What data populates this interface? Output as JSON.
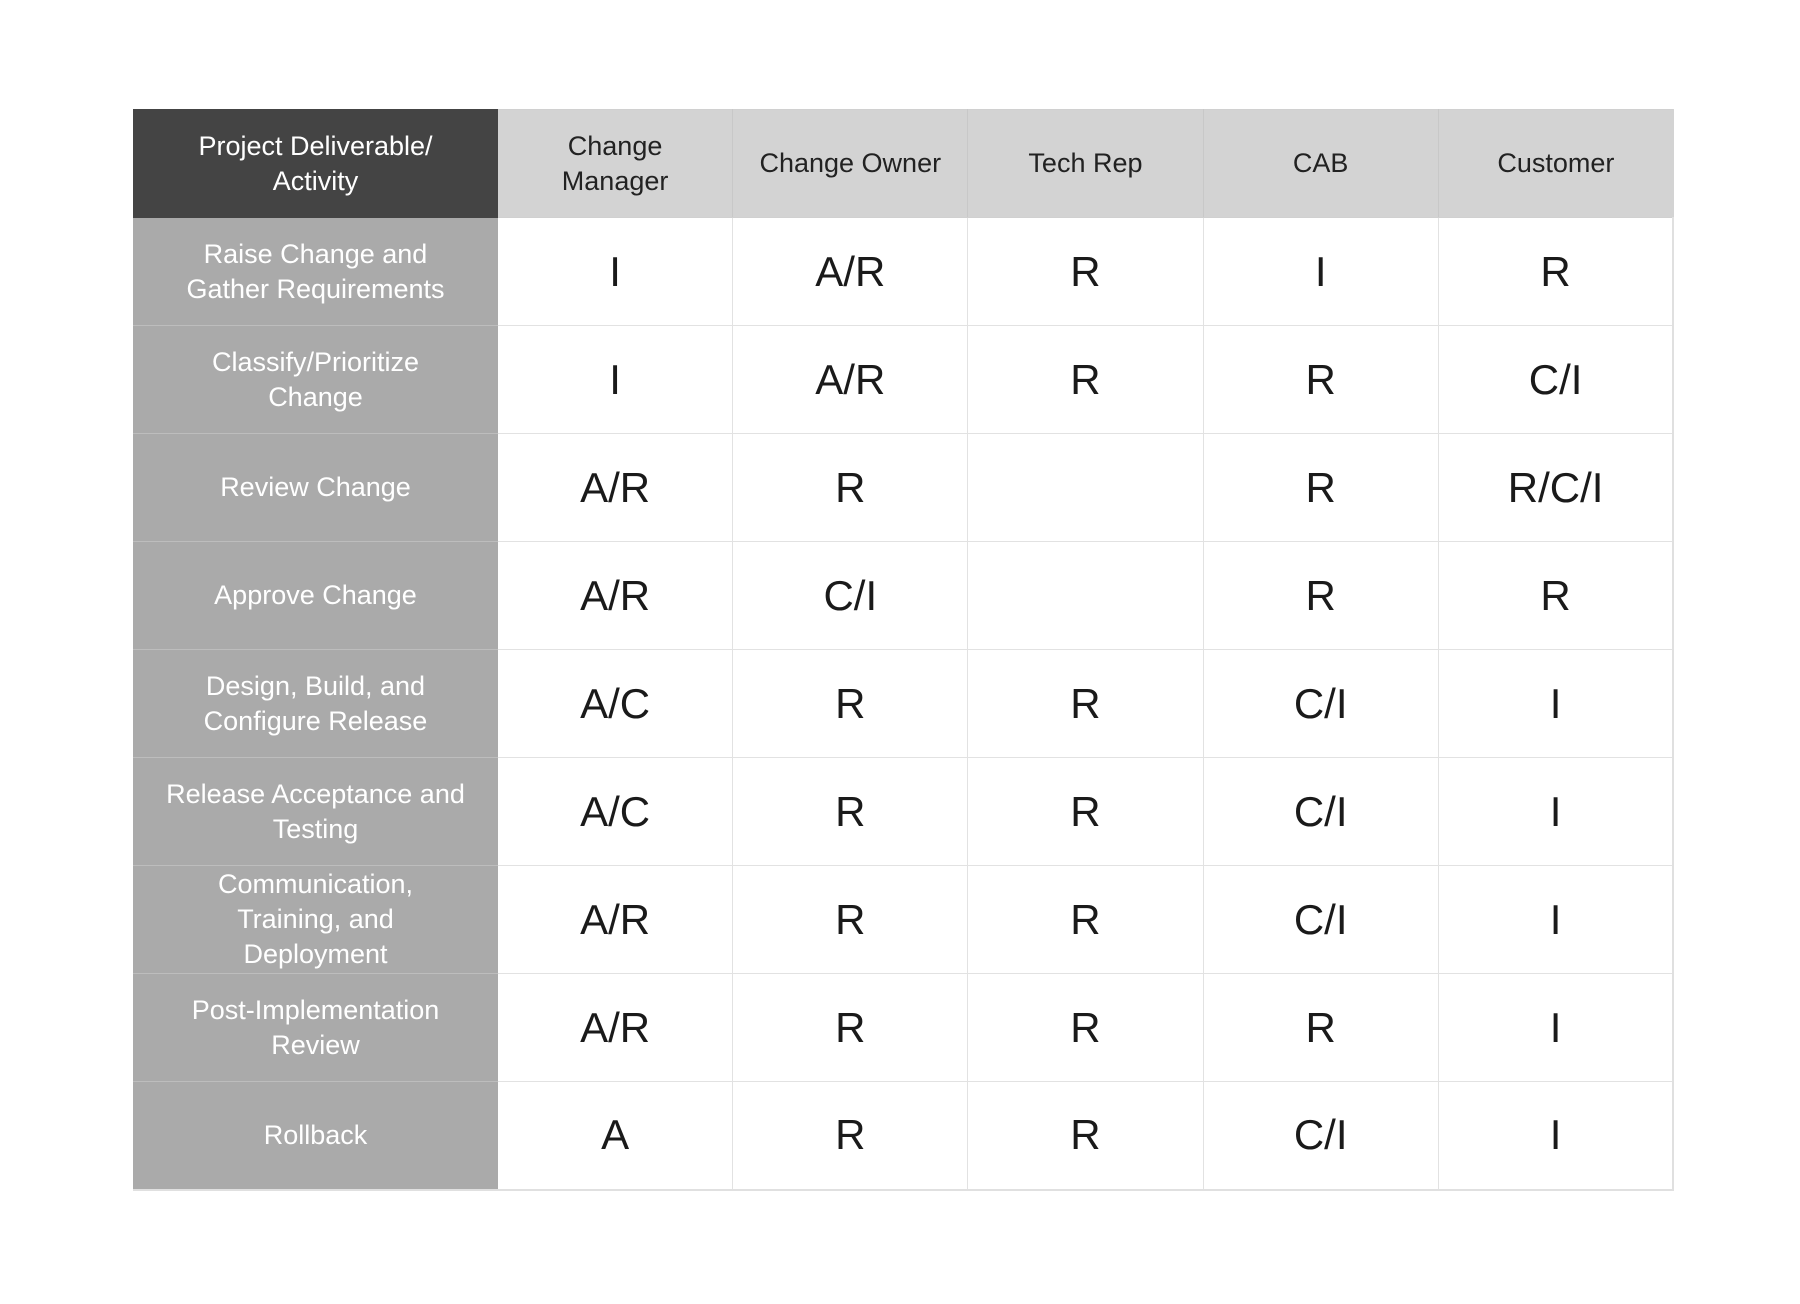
{
  "table": {
    "corner_header": "Project Deliverable/\nActivity",
    "roles": [
      "Change\nManager",
      "Change Owner",
      "Tech Rep",
      "CAB",
      "Customer"
    ],
    "rows": [
      {
        "activity": "Raise Change and\nGather Requirements",
        "values": [
          "I",
          "A/R",
          "R",
          "I",
          "R"
        ]
      },
      {
        "activity": "Classify/Prioritize\nChange",
        "values": [
          "I",
          "A/R",
          "R",
          "R",
          "C/I"
        ]
      },
      {
        "activity": "Review Change",
        "values": [
          "A/R",
          "R",
          "",
          "R",
          "R/C/I"
        ]
      },
      {
        "activity": "Approve Change",
        "values": [
          "A/R",
          "C/I",
          "",
          "R",
          "R"
        ]
      },
      {
        "activity": "Design, Build, and\nConfigure Release",
        "values": [
          "A/C",
          "R",
          "R",
          "C/I",
          "I"
        ]
      },
      {
        "activity": "Release Acceptance and\nTesting",
        "values": [
          "A/C",
          "R",
          "R",
          "C/I",
          "I"
        ]
      },
      {
        "activity": "Communication,\nTraining, and\nDeployment",
        "values": [
          "A/R",
          "R",
          "R",
          "C/I",
          "I"
        ]
      },
      {
        "activity": "Post-Implementation\nReview",
        "values": [
          "A/R",
          "R",
          "R",
          "R",
          "I"
        ]
      },
      {
        "activity": "Rollback",
        "values": [
          "A",
          "R",
          "R",
          "C/I",
          "I"
        ]
      }
    ]
  },
  "colors": {
    "corner_bg": "#444444",
    "header_bg": "#d3d3d3",
    "activity_bg": "#aaaaaa",
    "cell_bg": "#ffffff",
    "text_dark": "#1a1a1a",
    "text_light": "#ffffff"
  }
}
